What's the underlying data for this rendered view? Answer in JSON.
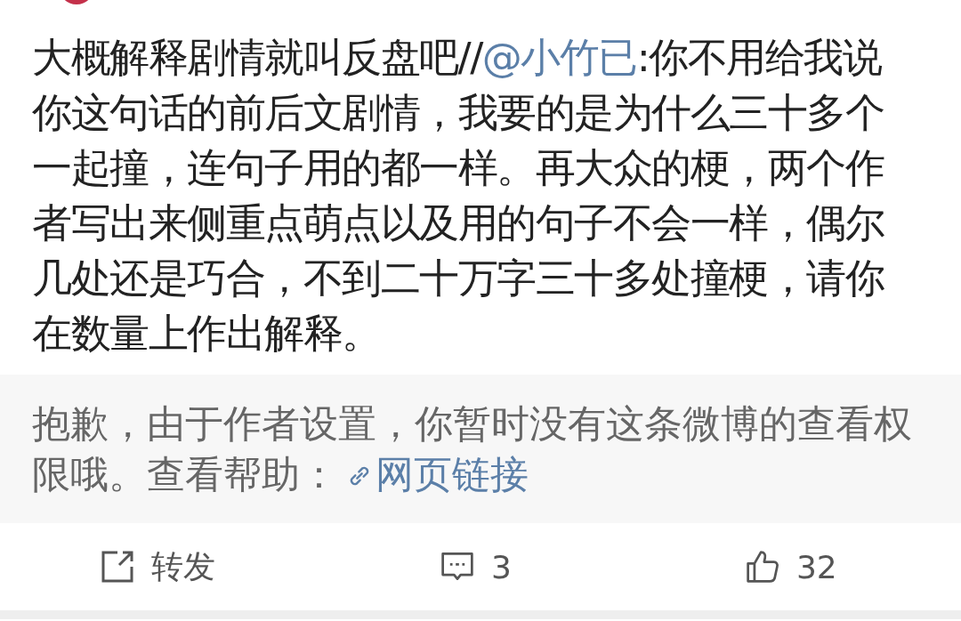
{
  "post": {
    "text_before": "大概解释剧情就叫反盘吧//",
    "mention": "@小竹已",
    "text_after": ":你不用给我说你这句话的前后文剧情，我要的是为什么三十多个一起撞，连句子用的都一样。再大众的梗，两个作者写出来侧重点萌点以及用的句子不会一样，偶尔几处还是巧合，不到二十万字三十多处撞梗，请你在数量上作出解释。"
  },
  "notice": {
    "text": "抱歉，由于作者设置，你暂时没有这条微博的查看权限哦。查看帮助：",
    "link": "网页链接"
  },
  "actions": [
    {
      "kind": "repost",
      "label": "转发"
    },
    {
      "kind": "comment",
      "label": "3"
    },
    {
      "kind": "like",
      "label": "32"
    }
  ]
}
